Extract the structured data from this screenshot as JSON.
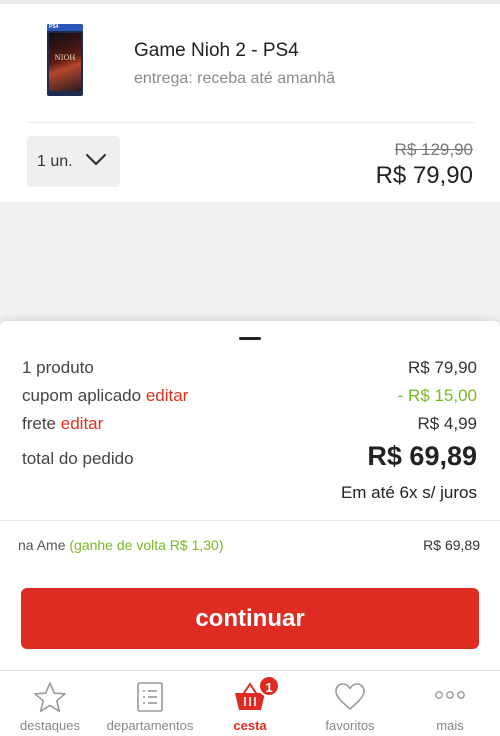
{
  "product": {
    "name": "Game Nioh 2 - PS4",
    "delivery": "entrega: receba até amanhã",
    "box_brand": "PS4",
    "box_logo": "NIOH",
    "quantity": "1 un.",
    "old_price": "R$ 129,90",
    "price": "R$ 79,90"
  },
  "summary": {
    "products_label": "1 produto",
    "products_value": "R$ 79,90",
    "coupon_label": "cupom aplicado",
    "coupon_edit": "editar",
    "coupon_value": "- R$ 15,00",
    "shipping_label": "frete",
    "shipping_edit": "editar",
    "shipping_value": "R$ 4,99",
    "total_label": "total do pedido",
    "total_value": "R$ 69,89",
    "installments": "Em até 6x s/ juros",
    "ame_label": "na Ame",
    "ame_bonus": "(ganhe de volta R$ 1,30)",
    "ame_value": "R$ 69,89"
  },
  "continue_label": "continuar",
  "tabbar": {
    "tabs": [
      {
        "label": "destaques",
        "icon": "star-icon"
      },
      {
        "label": "departamentos",
        "icon": "list-icon"
      },
      {
        "label": "cesta",
        "icon": "basket-icon",
        "active": true,
        "badge": "1"
      },
      {
        "label": "favoritos",
        "icon": "heart-icon"
      },
      {
        "label": "mais",
        "icon": "more-icon"
      }
    ]
  },
  "colors": {
    "brand_red": "#de2c23",
    "discount_green": "#79b922"
  }
}
